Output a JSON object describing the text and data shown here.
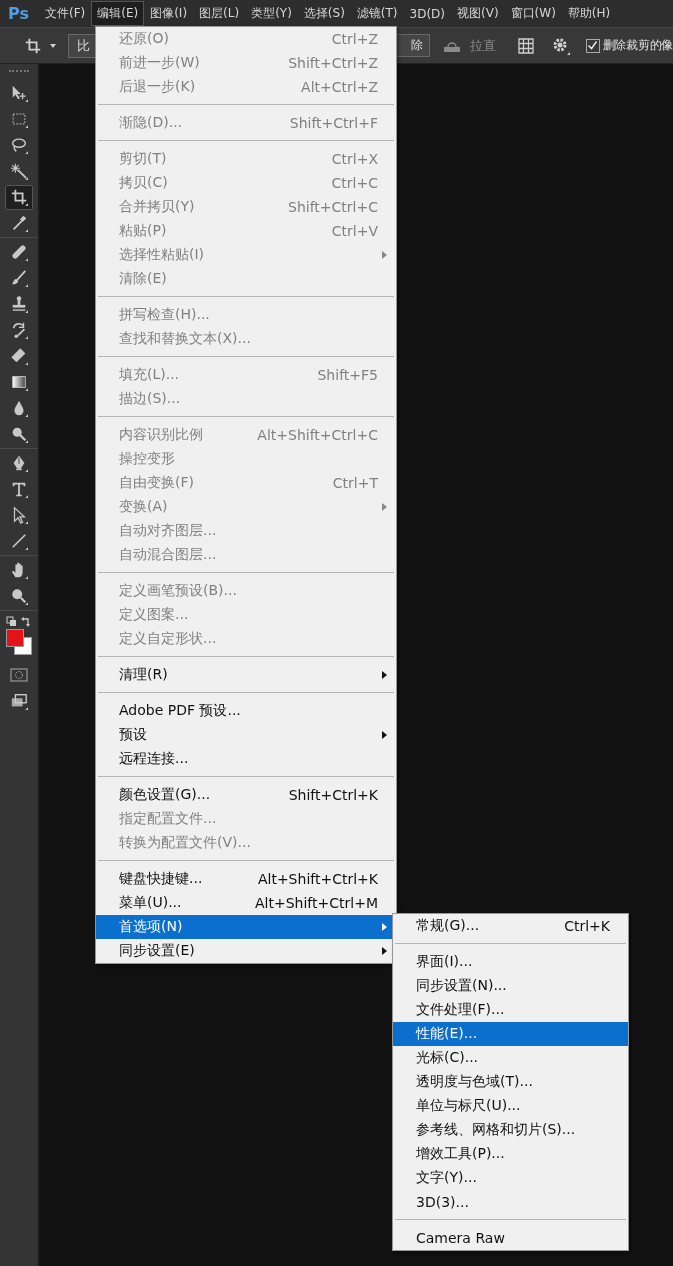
{
  "app": {
    "logo": "Ps"
  },
  "menubar": [
    {
      "label": "文件(F)",
      "selected": false
    },
    {
      "label": "编辑(E)",
      "selected": true
    },
    {
      "label": "图像(I)",
      "selected": false
    },
    {
      "label": "图层(L)",
      "selected": false
    },
    {
      "label": "类型(Y)",
      "selected": false
    },
    {
      "label": "选择(S)",
      "selected": false
    },
    {
      "label": "滤镜(T)",
      "selected": false
    },
    {
      "label": "3D(D)",
      "selected": false
    },
    {
      "label": "视图(V)",
      "selected": false
    },
    {
      "label": "窗口(W)",
      "selected": false
    },
    {
      "label": "帮助(H)",
      "selected": false
    }
  ],
  "options_bar": {
    "ratio_field": "比",
    "clear_button": "除",
    "straighten_label": "拉直",
    "delete_cropped": {
      "label": "删除裁剪的像",
      "checked": true
    }
  },
  "toolbar": {
    "groups": [
      [
        {
          "kind": "move",
          "selected": false
        },
        {
          "kind": "marquee",
          "selected": false
        },
        {
          "kind": "lasso",
          "selected": false
        },
        {
          "kind": "wand",
          "selected": false
        },
        {
          "kind": "crop",
          "selected": true
        },
        {
          "kind": "eyedropper",
          "selected": false
        }
      ],
      [
        {
          "kind": "heal",
          "selected": false
        },
        {
          "kind": "brush",
          "selected": false
        },
        {
          "kind": "stamp",
          "selected": false
        },
        {
          "kind": "history",
          "selected": false
        },
        {
          "kind": "eraser",
          "selected": false
        },
        {
          "kind": "gradient",
          "selected": false
        },
        {
          "kind": "blur",
          "selected": false
        },
        {
          "kind": "dodge",
          "selected": false
        }
      ],
      [
        {
          "kind": "pen",
          "selected": false
        },
        {
          "kind": "type",
          "selected": false
        },
        {
          "kind": "select",
          "selected": false
        },
        {
          "kind": "line",
          "selected": false
        }
      ],
      [
        {
          "kind": "hand",
          "selected": false
        },
        {
          "kind": "zoom",
          "selected": false
        }
      ]
    ]
  },
  "edit_menu": {
    "groups": [
      [
        {
          "label": "还原(O)",
          "shortcut": "Ctrl+Z",
          "disabled": true,
          "submenu": false,
          "selected": false
        },
        {
          "label": "前进一步(W)",
          "shortcut": "Shift+Ctrl+Z",
          "disabled": true,
          "submenu": false,
          "selected": false
        },
        {
          "label": "后退一步(K)",
          "shortcut": "Alt+Ctrl+Z",
          "disabled": true,
          "submenu": false,
          "selected": false
        }
      ],
      [
        {
          "label": "渐隐(D)...",
          "shortcut": "Shift+Ctrl+F",
          "disabled": true,
          "submenu": false,
          "selected": false
        }
      ],
      [
        {
          "label": "剪切(T)",
          "shortcut": "Ctrl+X",
          "disabled": true,
          "submenu": false,
          "selected": false
        },
        {
          "label": "拷贝(C)",
          "shortcut": "Ctrl+C",
          "disabled": true,
          "submenu": false,
          "selected": false
        },
        {
          "label": "合并拷贝(Y)",
          "shortcut": "Shift+Ctrl+C",
          "disabled": true,
          "submenu": false,
          "selected": false
        },
        {
          "label": "粘贴(P)",
          "shortcut": "Ctrl+V",
          "disabled": true,
          "submenu": false,
          "selected": false
        },
        {
          "label": "选择性粘贴(I)",
          "disabled": true,
          "submenu": true,
          "selected": false
        },
        {
          "label": "清除(E)",
          "disabled": true,
          "submenu": false,
          "selected": false
        }
      ],
      [
        {
          "label": "拼写检查(H)...",
          "disabled": true,
          "submenu": false,
          "selected": false
        },
        {
          "label": "查找和替换文本(X)...",
          "disabled": true,
          "submenu": false,
          "selected": false
        }
      ],
      [
        {
          "label": "填充(L)...",
          "shortcut": "Shift+F5",
          "disabled": true,
          "submenu": false,
          "selected": false
        },
        {
          "label": "描边(S)...",
          "disabled": true,
          "submenu": false,
          "selected": false
        }
      ],
      [
        {
          "label": "内容识别比例",
          "shortcut": "Alt+Shift+Ctrl+C",
          "disabled": true,
          "submenu": false,
          "selected": false
        },
        {
          "label": "操控变形",
          "disabled": true,
          "submenu": false,
          "selected": false
        },
        {
          "label": "自由变换(F)",
          "shortcut": "Ctrl+T",
          "disabled": true,
          "submenu": false,
          "selected": false
        },
        {
          "label": "变换(A)",
          "disabled": true,
          "submenu": true,
          "selected": false
        },
        {
          "label": "自动对齐图层...",
          "disabled": true,
          "submenu": false,
          "selected": false
        },
        {
          "label": "自动混合图层...",
          "disabled": true,
          "submenu": false,
          "selected": false
        }
      ],
      [
        {
          "label": "定义画笔预设(B)...",
          "disabled": true,
          "submenu": false,
          "selected": false
        },
        {
          "label": "定义图案...",
          "disabled": true,
          "submenu": false,
          "selected": false
        },
        {
          "label": "定义自定形状...",
          "disabled": true,
          "submenu": false,
          "selected": false
        }
      ],
      [
        {
          "label": "清理(R)",
          "disabled": false,
          "submenu": true,
          "selected": false
        }
      ],
      [
        {
          "label": "Adobe PDF 预设...",
          "disabled": false,
          "submenu": false,
          "selected": false
        },
        {
          "label": "预设",
          "disabled": false,
          "submenu": true,
          "selected": false
        },
        {
          "label": "远程连接...",
          "disabled": false,
          "submenu": false,
          "selected": false
        }
      ],
      [
        {
          "label": "颜色设置(G)...",
          "shortcut": "Shift+Ctrl+K",
          "disabled": false,
          "submenu": false,
          "selected": false
        },
        {
          "label": "指定配置文件...",
          "disabled": true,
          "submenu": false,
          "selected": false
        },
        {
          "label": "转换为配置文件(V)...",
          "disabled": true,
          "submenu": false,
          "selected": false
        }
      ],
      [
        {
          "label": "键盘快捷键...",
          "shortcut": "Alt+Shift+Ctrl+K",
          "disabled": false,
          "submenu": false,
          "selected": false
        },
        {
          "label": "菜单(U)...",
          "shortcut": "Alt+Shift+Ctrl+M",
          "disabled": false,
          "submenu": false,
          "selected": false
        },
        {
          "label": "首选项(N)",
          "disabled": false,
          "submenu": true,
          "selected": true
        },
        {
          "label": "同步设置(E)",
          "disabled": false,
          "submenu": true,
          "selected": false
        }
      ]
    ]
  },
  "preferences_submenu": {
    "groups": [
      [
        {
          "label": "常规(G)...",
          "shortcut": "Ctrl+K",
          "disabled": false,
          "submenu": false,
          "selected": false
        }
      ],
      [
        {
          "label": "界面(I)...",
          "disabled": false,
          "submenu": false,
          "selected": false
        },
        {
          "label": "同步设置(N)...",
          "disabled": false,
          "submenu": false,
          "selected": false
        },
        {
          "label": "文件处理(F)...",
          "disabled": false,
          "submenu": false,
          "selected": false
        },
        {
          "label": "性能(E)...",
          "disabled": false,
          "submenu": false,
          "selected": true
        },
        {
          "label": "光标(C)...",
          "disabled": false,
          "submenu": false,
          "selected": false
        },
        {
          "label": "透明度与色域(T)...",
          "disabled": false,
          "submenu": false,
          "selected": false
        },
        {
          "label": "单位与标尺(U)...",
          "disabled": false,
          "submenu": false,
          "selected": false
        },
        {
          "label": "参考线、网格和切片(S)...",
          "disabled": false,
          "submenu": false,
          "selected": false
        },
        {
          "label": "增效工具(P)...",
          "disabled": false,
          "submenu": false,
          "selected": false
        },
        {
          "label": "文字(Y)...",
          "disabled": false,
          "submenu": false,
          "selected": false
        },
        {
          "label": "3D(3)...",
          "disabled": false,
          "submenu": false,
          "selected": false
        }
      ],
      [
        {
          "label": "Camera Raw",
          "disabled": false,
          "submenu": false,
          "selected": false
        }
      ]
    ]
  }
}
